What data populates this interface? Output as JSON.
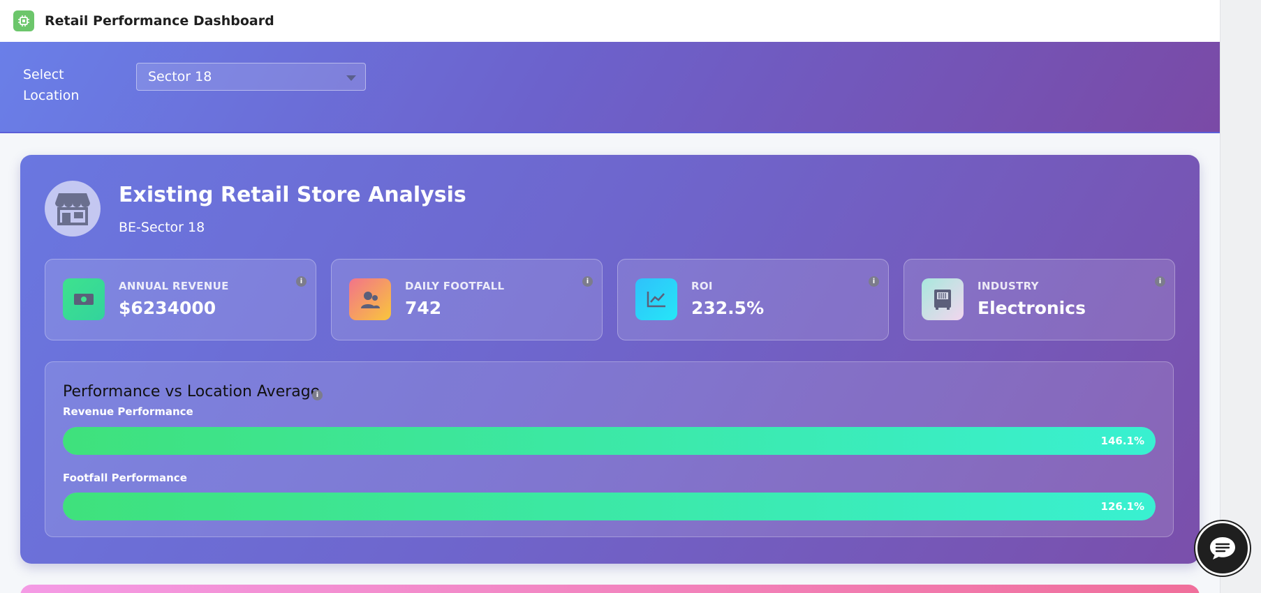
{
  "header": {
    "title": "Retail Performance Dashboard",
    "logo_icon": "chip-icon"
  },
  "location": {
    "label": "Select Location",
    "selected": "Sector 18"
  },
  "analysis": {
    "title": "Existing Retail Store Analysis",
    "subtitle": "BE-Sector 18",
    "metrics": [
      {
        "label": "ANNUAL REVENUE",
        "value": "$6234000",
        "icon": "money-icon",
        "accent": "#3ee28e"
      },
      {
        "label": "DAILY FOOTFALL",
        "value": "742",
        "icon": "users-icon",
        "accent": "#f7b14a"
      },
      {
        "label": "ROI",
        "value": "232.5%",
        "icon": "chart-line-icon",
        "accent": "#26d6f7"
      },
      {
        "label": "INDUSTRY",
        "value": "Electronics",
        "icon": "appliance-icon",
        "accent": "#b9e9e1"
      }
    ],
    "performance": {
      "title": "Performance vs Location Average",
      "bars": [
        {
          "label": "Revenue Performance",
          "value": "146.1%",
          "fill_fraction": 1.0
        },
        {
          "label": "Footfall Performance",
          "value": "126.1%",
          "fill_fraction": 1.0
        }
      ]
    }
  },
  "colors": {
    "brand_gradient_start": "#6a7fe8",
    "brand_gradient_end": "#7a4aa6",
    "bar_start": "#3fe17c",
    "bar_end": "#39f0d1"
  }
}
